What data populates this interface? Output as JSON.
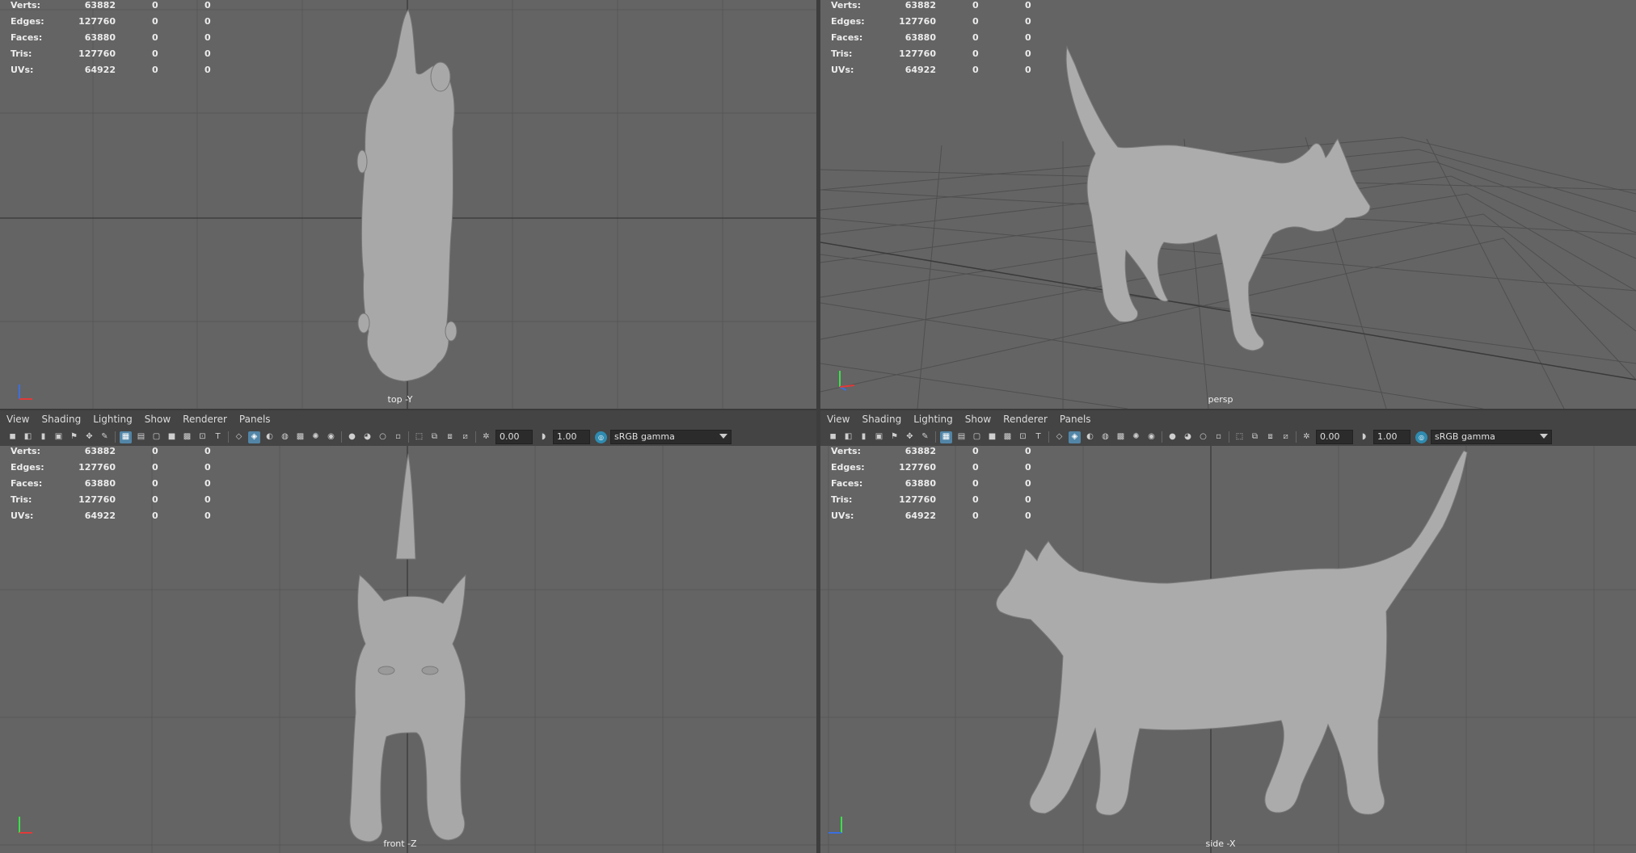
{
  "stats_headers": [
    "Verts:",
    "Edges:",
    "Faces:",
    "Tris:",
    "UVs:"
  ],
  "stats": [
    {
      "label": "Verts:",
      "v1": "63882",
      "v2": "0",
      "v3": "0"
    },
    {
      "label": "Edges:",
      "v1": "127760",
      "v2": "0",
      "v3": "0"
    },
    {
      "label": "Faces:",
      "v1": "63880",
      "v2": "0",
      "v3": "0"
    },
    {
      "label": "Tris:",
      "v1": "127760",
      "v2": "0",
      "v3": "0"
    },
    {
      "label": "UVs:",
      "v1": "64922",
      "v2": "0",
      "v3": "0"
    }
  ],
  "viewports": {
    "top": {
      "camera": "top -Y"
    },
    "persp": {
      "camera": "persp"
    },
    "front": {
      "camera": "front -Z"
    },
    "side": {
      "camera": "side -X"
    }
  },
  "panel_menu": [
    "View",
    "Shading",
    "Lighting",
    "Show",
    "Renderer",
    "Panels"
  ],
  "toolbar": {
    "exposure": "0.00",
    "gamma": "1.00",
    "color_space": "sRGB gamma"
  },
  "colors": {
    "viewport_bg": "#646464",
    "grid": "#555555",
    "grid_axis": "#3c3c3c",
    "model": "#a9a9a9",
    "accent": "#5285a6"
  }
}
